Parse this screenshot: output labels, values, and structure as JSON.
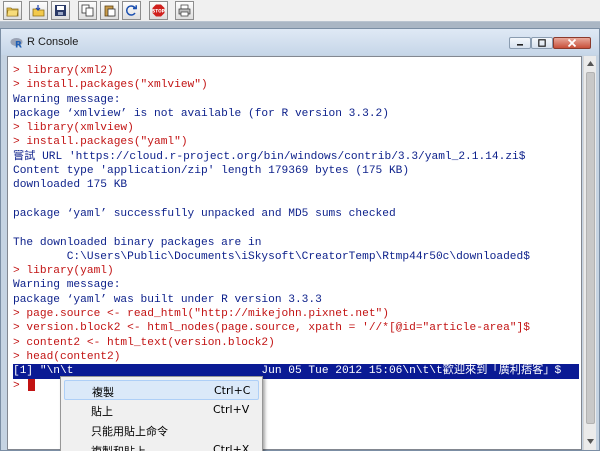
{
  "toolbar": {
    "buttons": [
      "open-script",
      "load-workspace",
      "save-workspace",
      "copy",
      "paste",
      "copy-paste",
      "stop",
      "print"
    ]
  },
  "window": {
    "title": "R Console"
  },
  "console": {
    "lines": [
      {
        "type": "cmd",
        "text": "> library(xml2)"
      },
      {
        "type": "cmd",
        "text": "> install.packages(\"xmlview\")"
      },
      {
        "type": "out",
        "text": "Warning message:"
      },
      {
        "type": "out",
        "text": "package ‘xmlview’ is not available (for R version 3.3.2)"
      },
      {
        "type": "cmd",
        "text": "> library(xmlview)"
      },
      {
        "type": "cmd",
        "text": "> install.packages(\"yaml\")"
      },
      {
        "type": "out",
        "text": "嘗試 URL 'https://cloud.r-project.org/bin/windows/contrib/3.3/yaml_2.1.14.zi$"
      },
      {
        "type": "out",
        "text": "Content type 'application/zip' length 179369 bytes (175 KB)"
      },
      {
        "type": "out",
        "text": "downloaded 175 KB"
      },
      {
        "type": "out",
        "text": ""
      },
      {
        "type": "out",
        "text": "package ‘yaml’ successfully unpacked and MD5 sums checked"
      },
      {
        "type": "out",
        "text": ""
      },
      {
        "type": "out",
        "text": "The downloaded binary packages are in"
      },
      {
        "type": "out",
        "text": "        C:\\Users\\Public\\Documents\\iSkysoft\\CreatorTemp\\Rtmp44r50c\\downloaded$"
      },
      {
        "type": "cmd",
        "text": "> library(yaml)"
      },
      {
        "type": "out",
        "text": "Warning message:"
      },
      {
        "type": "out",
        "text": "package ‘yaml’ was built under R version 3.3.3"
      },
      {
        "type": "cmd",
        "text": "> page.source <- read_html(\"http://mikejohn.pixnet.net\")"
      },
      {
        "type": "cmd",
        "text": "> version.block2 <- html_nodes(page.source, xpath = '//*[@id=\"article-area\"]$"
      },
      {
        "type": "cmd",
        "text": "> content2 <- html_text(version.block2)"
      },
      {
        "type": "cmd",
        "text": "> head(content2)"
      },
      {
        "type": "sel",
        "text": "[1] \"\\n\\t                            Jun 05 Tue 2012 15:06\\n\\t\\t歡迎來到「廣利痞客」$"
      },
      {
        "type": "prompt",
        "text": "> "
      }
    ]
  },
  "context_menu": {
    "items": [
      {
        "label": "複製",
        "shortcut": "Ctrl+C"
      },
      {
        "label": "貼上",
        "shortcut": "Ctrl+V"
      },
      {
        "label": "只能用貼上命令",
        "shortcut": ""
      },
      {
        "label": "複製和貼上",
        "shortcut": "Ctrl+X"
      }
    ]
  }
}
